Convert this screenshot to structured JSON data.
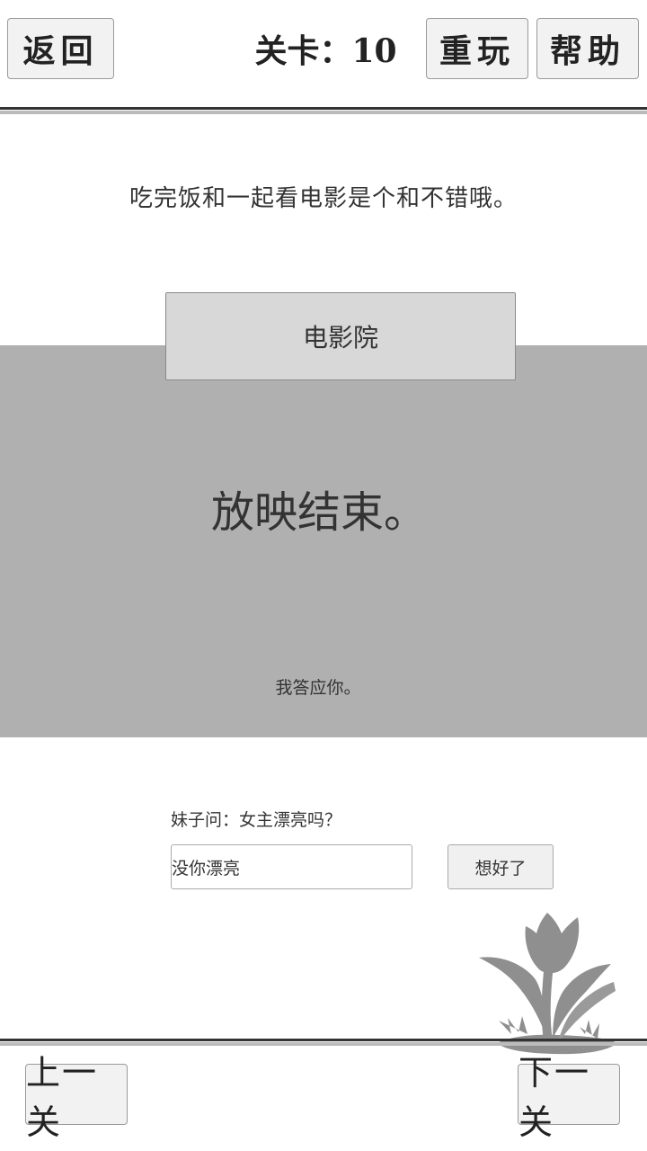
{
  "header": {
    "back_label": "返回",
    "level_label": "关卡：10",
    "replay_label": "重玩",
    "help_label": "帮助"
  },
  "puzzle": {
    "prompt": "吃完饭和一起看电影是个和不错哦。",
    "place_label": "电影院",
    "scene_big_text": "放映结束。",
    "scene_small_text": "我答应你。"
  },
  "answer": {
    "question": "妹子问：女主漂亮吗？",
    "input_value": "没你漂亮",
    "confirm_label": "想好了"
  },
  "footer": {
    "prev_label": "上一关",
    "next_label": "下一关"
  },
  "icons": {
    "decoration": "tulip-icon"
  },
  "colors": {
    "panel_gray": "#b0b0b0",
    "button_bg": "#f2f2f2",
    "place_button_bg": "#d8d8d8"
  }
}
